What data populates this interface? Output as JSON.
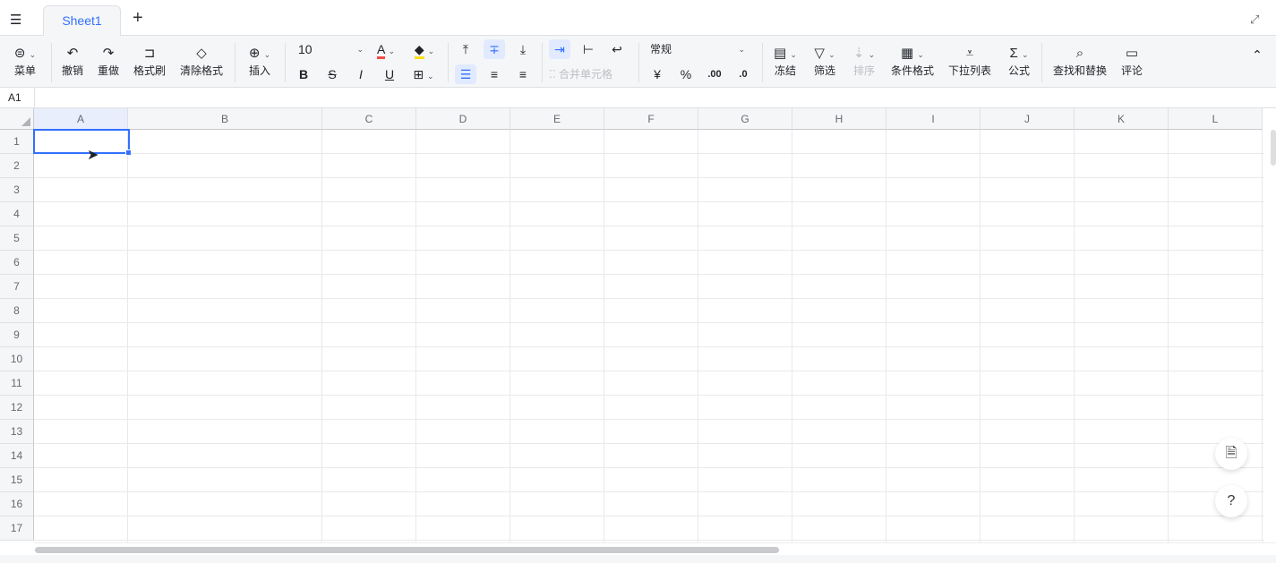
{
  "tabs": {
    "active": "Sheet1",
    "add_icon": "plus-icon",
    "layers_icon": "layers-icon"
  },
  "toolbar": {
    "menu": "菜单",
    "undo": "撤销",
    "redo": "重做",
    "format_painter": "格式刷",
    "clear_format": "清除格式",
    "insert": "插入",
    "font_size": "10",
    "bold": "B",
    "strike": "S",
    "italic": "I",
    "underline": "U",
    "merge": "合并单元格",
    "number_format": "常规",
    "currency": "¥",
    "percent": "%",
    "dec_inc": ".00",
    "dec_dec": ".0",
    "freeze": "冻结",
    "filter": "筛选",
    "sort": "排序",
    "cond_format": "条件格式",
    "dropdown": "下拉列表",
    "formula": "公式",
    "find_replace": "查找和替换",
    "comment": "评论",
    "font_color": "#f54a45",
    "fill_color": "#fadf1e",
    "accent": "#3370ff"
  },
  "formula_bar": {
    "cell_ref": "A1",
    "value": ""
  },
  "columns": [
    "A",
    "B",
    "C",
    "D",
    "E",
    "F",
    "G",
    "H",
    "I",
    "J",
    "K",
    "L"
  ],
  "rows": [
    "1",
    "2",
    "3",
    "4",
    "5",
    "6",
    "7",
    "8",
    "9",
    "10",
    "11",
    "12",
    "13",
    "14",
    "15",
    "16",
    "17"
  ],
  "selected_cell": "A1"
}
